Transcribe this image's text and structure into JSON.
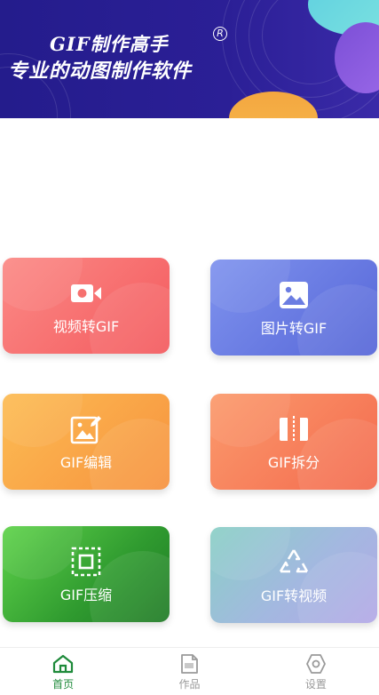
{
  "banner": {
    "title": "GIF制作高手",
    "registered": "R",
    "subtitle": "专业的动图制作软件"
  },
  "colors": {
    "banner_bg": "#2b1f96",
    "accent_green": "#1e8a3a",
    "nav_inactive": "#9a9a9a"
  },
  "tools": [
    {
      "label": "视频转GIF",
      "icon": "video-camera-icon",
      "color": "#f45a5e"
    },
    {
      "label": "图片转GIF",
      "icon": "image-icon",
      "color": "#5666d8"
    },
    {
      "label": "GIF编辑",
      "icon": "image-edit-icon",
      "color": "#f7923e"
    },
    {
      "label": "GIF拆分",
      "icon": "split-icon",
      "color": "#f46a4e"
    },
    {
      "label": "GIF压缩",
      "icon": "compress-icon",
      "color": "#2f9a2f"
    },
    {
      "label": "GIF转视频",
      "icon": "recycle-convert-icon",
      "color": "#a3b8e0"
    }
  ],
  "bottom_nav": [
    {
      "label": "首页",
      "icon": "home-icon",
      "active": true
    },
    {
      "label": "作品",
      "icon": "gif-file-icon",
      "active": false
    },
    {
      "label": "设置",
      "icon": "settings-gear-icon",
      "active": false
    }
  ]
}
